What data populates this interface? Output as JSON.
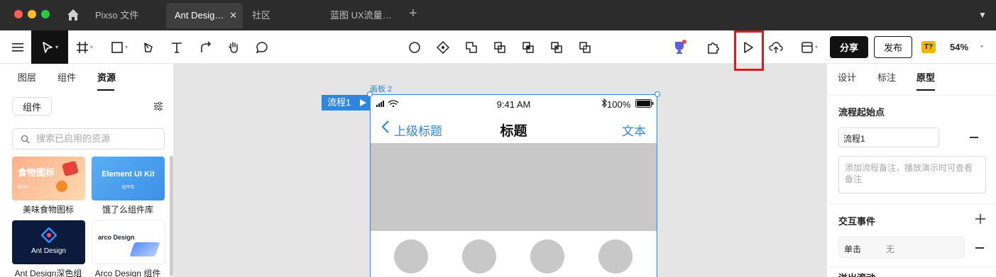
{
  "titlebar": {
    "tabs": [
      {
        "label": "Pixso 文件"
      },
      {
        "label": "Ant Desig…"
      },
      {
        "label": "社区"
      },
      {
        "label": "蓝图 UX流量…"
      }
    ],
    "close_glyph": "✕",
    "new_tab_glyph": "+",
    "menu_glyph": "▼"
  },
  "toolbar": {
    "share_label": "分享",
    "publish_label": "发布",
    "zoom": "54%",
    "badge": "T?"
  },
  "left_panel": {
    "tabs": [
      {
        "label": "图层"
      },
      {
        "label": "组件"
      },
      {
        "label": "资源"
      }
    ],
    "filter_label": "组件",
    "search_placeholder": "搜索已启用的资源",
    "libraries": [
      {
        "label": "美味食物图标",
        "thumb_title": "食物图标",
        "thumb_sub": "icon"
      },
      {
        "label": "饿了么组件库",
        "thumb_title": "Element UI Kit",
        "thumb_sub": "组件库"
      },
      {
        "label": "Ant Design深色组",
        "thumb_title": "Ant Design"
      },
      {
        "label": "Arco Design 组件",
        "thumb_title": "arco Design"
      }
    ]
  },
  "canvas": {
    "frame_title": "画板 2",
    "flow_tag": "流程1",
    "phone": {
      "time": "9:41 AM",
      "battery": "100%",
      "back_label": "上级标题",
      "title": "标题",
      "right_label": "文本"
    }
  },
  "right_panel": {
    "tabs": [
      {
        "label": "设计"
      },
      {
        "label": "标注"
      },
      {
        "label": "原型"
      }
    ],
    "flow_start_title": "流程起始点",
    "flow_name": "流程1",
    "remark_placeholder": "添加流程备注，播放演示时可查看备注",
    "interaction_title": "交互事件",
    "event_trigger": "单击",
    "event_action": "无",
    "overflow_title": "溢出滚动"
  },
  "colors": {
    "accent": "#2e86de",
    "highlight": "#d71e1e",
    "dark": "#2c2c2c"
  }
}
